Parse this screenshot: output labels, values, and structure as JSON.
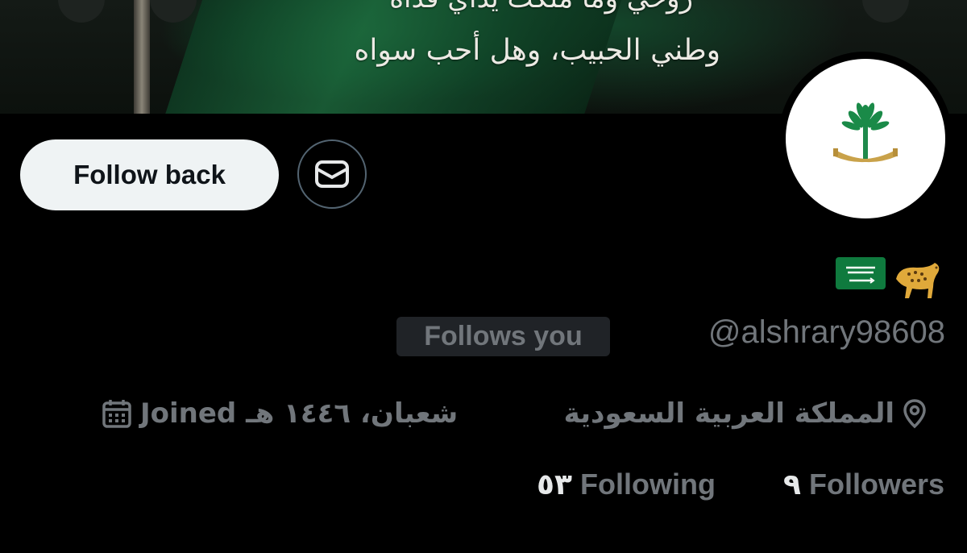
{
  "banner": {
    "line1": "روحي وما ملكت يداي فداه",
    "line2": "وطني الحبيب، وهل أحب سواه"
  },
  "profile": {
    "avatar_icon": "saudi-emblem-icon",
    "emojis": [
      "🐆",
      "🇸🇦"
    ],
    "handle": "@alshrary98608",
    "follows_you": "Follows you",
    "location": "المملكة العربية السعودية",
    "joined": "Joined شعبان، ١٤٤٦ هـ",
    "following_count": "٥٣",
    "following_label": "Following",
    "followers_count": "٩",
    "followers_label": "Followers"
  },
  "actions": {
    "follow_back": "Follow back",
    "message_icon": "envelope-icon"
  },
  "colors": {
    "background": "#000000",
    "muted": "#71767b",
    "button": "#eff3f4",
    "text": "#e7e9ea"
  }
}
